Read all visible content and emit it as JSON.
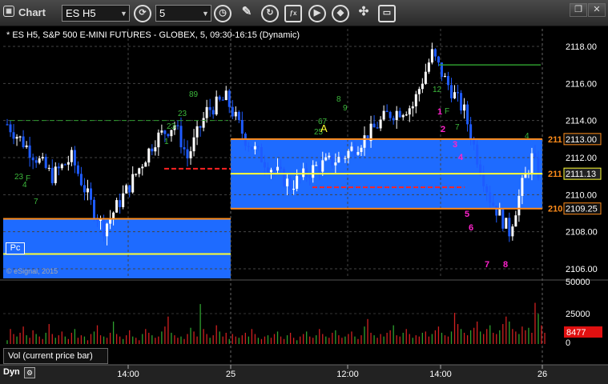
{
  "toolbar": {
    "chart_label": "Chart",
    "symbol": "ES H5",
    "interval": "5",
    "icons": [
      "refresh-icon",
      "clock-icon",
      "pencil-icon",
      "cycle-icon",
      "study-icon",
      "play-icon",
      "shape-icon",
      "link-icon",
      "note-icon"
    ]
  },
  "window": {
    "restore": "❐",
    "close": "✕"
  },
  "heading": "* ES H5, S&P 500 E-MINI FUTURES - GLOBEX, 5, 09:30-16:15 (Dynamic)",
  "watermark": "© eSignal, 2015",
  "pc_label": "Pc",
  "session_marker": "A",
  "volume_pane_label": "Vol (current price bar)",
  "dynamic_label": "Dyn",
  "colors": {
    "background": "#000000",
    "blue_zone": "#1e6bff",
    "up": "#ffffff",
    "down": "#1e5bff",
    "level": "#ff8c1a",
    "yellow": "#ffff33",
    "red": "#ff2222",
    "green_dash": "#2e9a2e",
    "magenta": "#ff22cc"
  },
  "chart_data": {
    "type": "candlestick",
    "symbol": "ES H5",
    "ylim": [
      2105.0,
      2119.5
    ],
    "y_ticks": [
      2106.0,
      2108.0,
      2110.0,
      2112.0,
      2114.0,
      2116.0,
      2118.0
    ],
    "x_ticks": [
      "14:00",
      "25",
      "12:00",
      "14:00",
      "26"
    ],
    "price_tags": [
      {
        "label": "2113.00",
        "value": 2113.0,
        "color": "#ff8c1a"
      },
      {
        "label": "2111.13",
        "value": 2111.13,
        "color": "#ffff33"
      },
      {
        "label": "2109.25",
        "value": 2109.25,
        "color": "#ff8c1a"
      }
    ],
    "truncated_tags": [
      {
        "label": "211",
        "value": 2113.0
      },
      {
        "label": "211",
        "value": 2111.13
      },
      {
        "label": "210",
        "value": 2109.25
      }
    ],
    "volume": {
      "ylim": [
        0,
        50000
      ],
      "ticks": [
        "50000",
        "25000",
        "0"
      ],
      "current": "8477",
      "values": [
        3000,
        12000,
        8000,
        6000,
        9000,
        14000,
        7000,
        5000,
        11000,
        8000,
        6000,
        4000,
        9000,
        16000,
        8000,
        5000,
        7000,
        10000,
        6000,
        4000,
        9000,
        12000,
        5000,
        7000,
        6000,
        3000,
        8000,
        10000,
        15000,
        7000,
        6000,
        5000,
        9000,
        18000,
        8000,
        6000,
        4000,
        7000,
        11000,
        6000,
        5000,
        3000,
        8000,
        12000,
        9000,
        7000,
        5000,
        6000,
        10000,
        14000,
        22000,
        9000,
        7000,
        5000,
        6000,
        4000,
        8000,
        13000,
        10000,
        6000,
        32000,
        12000,
        8000,
        5000,
        7000,
        15000,
        10000,
        6000,
        9000,
        4000,
        8000,
        6000,
        5000,
        7000,
        9000,
        6000,
        12000,
        8000,
        5000,
        4000,
        6000,
        7000,
        5000,
        8000,
        10000,
        6000,
        4000,
        7000,
        9000,
        5000,
        3000,
        6000,
        8000,
        10000,
        6000,
        5000,
        7000,
        12000,
        8000,
        6000,
        5000,
        9000,
        11000,
        7000,
        5000,
        6000,
        8000,
        10000,
        6000,
        4000,
        7000,
        14000,
        20000,
        9000,
        7000,
        5000,
        8000,
        6000,
        9000,
        11000,
        15000,
        7000,
        6000,
        9000,
        12000,
        8000,
        5000,
        7000,
        6000,
        9000,
        10000,
        6000,
        8000,
        11000,
        14000,
        9000,
        7000,
        6000,
        10000,
        25000,
        16000,
        12000,
        9000,
        7000,
        11000,
        13000,
        18000,
        10000,
        8000,
        12000,
        15000,
        9000,
        8000,
        11000,
        16000,
        22000,
        18000,
        12000,
        10000,
        8000,
        14000,
        11000,
        13000,
        9000,
        33000,
        24000,
        15000,
        9000
      ]
    }
  }
}
